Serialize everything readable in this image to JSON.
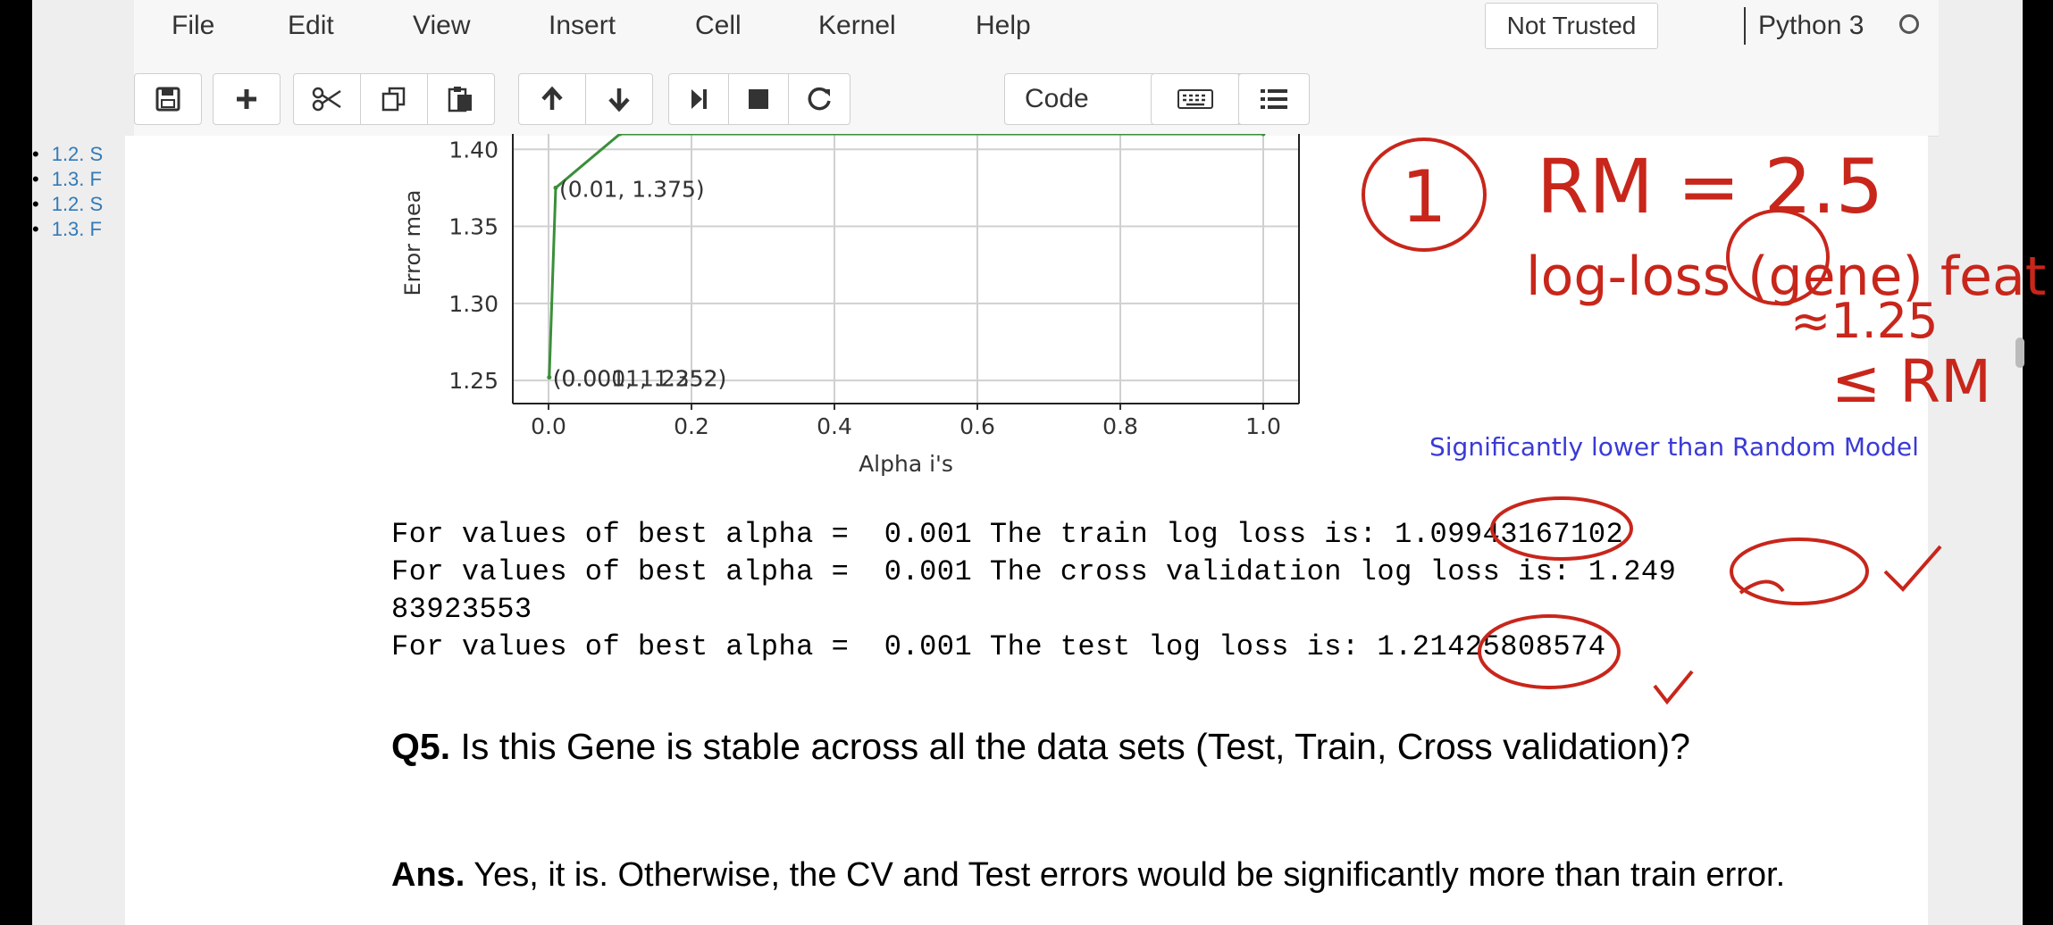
{
  "menu": {
    "items": [
      "File",
      "Edit",
      "View",
      "Insert",
      "Cell",
      "Kernel",
      "Help"
    ],
    "trust_label": "Not Trusted",
    "kernel_name": "Python 3"
  },
  "toolbar": {
    "cell_type": "Code",
    "icons": [
      "save-icon",
      "plus-icon",
      "cut-icon",
      "copy-icon",
      "paste-icon",
      "arrow-up-icon",
      "arrow-down-icon",
      "skip-icon",
      "stop-icon",
      "restart-icon",
      "keyboard-icon",
      "list-icon"
    ]
  },
  "toc": {
    "items": [
      "1.2. S",
      "1.3. F",
      "1.2. S",
      "1.3. F"
    ]
  },
  "chart_data": {
    "type": "line",
    "ylabel": "Error mea",
    "xlabel": "Alpha i's",
    "x_ticks": [
      "0.0",
      "0.2",
      "0.4",
      "0.6",
      "0.8",
      "1.0"
    ],
    "y_ticks": [
      "1.40",
      "1.35",
      "1.30",
      "1.25"
    ],
    "xlim": [
      -0.05,
      1.05
    ],
    "ylim": [
      1.235,
      1.41
    ],
    "series": [
      {
        "x": [
          0.001,
          0.01,
          0.1,
          1.0
        ],
        "y": [
          1.252,
          1.375,
          1.41,
          1.41
        ],
        "color": "#3a8f3a"
      }
    ],
    "annotations": [
      {
        "text": "(0.01, 1.375)",
        "x": 0.01,
        "y": 1.375
      },
      {
        "text": "(0.0001, 1.252)",
        "x": 0.001,
        "y": 1.252
      },
      {
        "text": "(0.001, 1.2352)",
        "x": 0.001,
        "y": 1.252
      }
    ]
  },
  "output": {
    "line1": "For values of best alpha =  0.001 The train log loss is: 1.09943167102",
    "line2": "For values of best alpha =  0.001 The cross validation log loss is: 1.249",
    "line3": "83923553",
    "line4": "For values of best alpha =  0.001 The test log loss is: 1.21425808574"
  },
  "q5": {
    "label": "Q5.",
    "text": " Is this Gene is stable across all the data sets (Test, Train, Cross validation)?"
  },
  "ans": {
    "label": "Ans.",
    "text": " Yes, it is. Otherwise, the CV and Test errors would be significantly more than train error."
  },
  "annotations": {
    "note": "Significantly lower than Random Model",
    "circle_number": "1",
    "rm_line": "RM = 2.5",
    "logloss_line": "log-loss (gene) feat",
    "approx_line": "≈1.25",
    "le_rm": "≤ RM",
    "color": "#c8261b"
  }
}
